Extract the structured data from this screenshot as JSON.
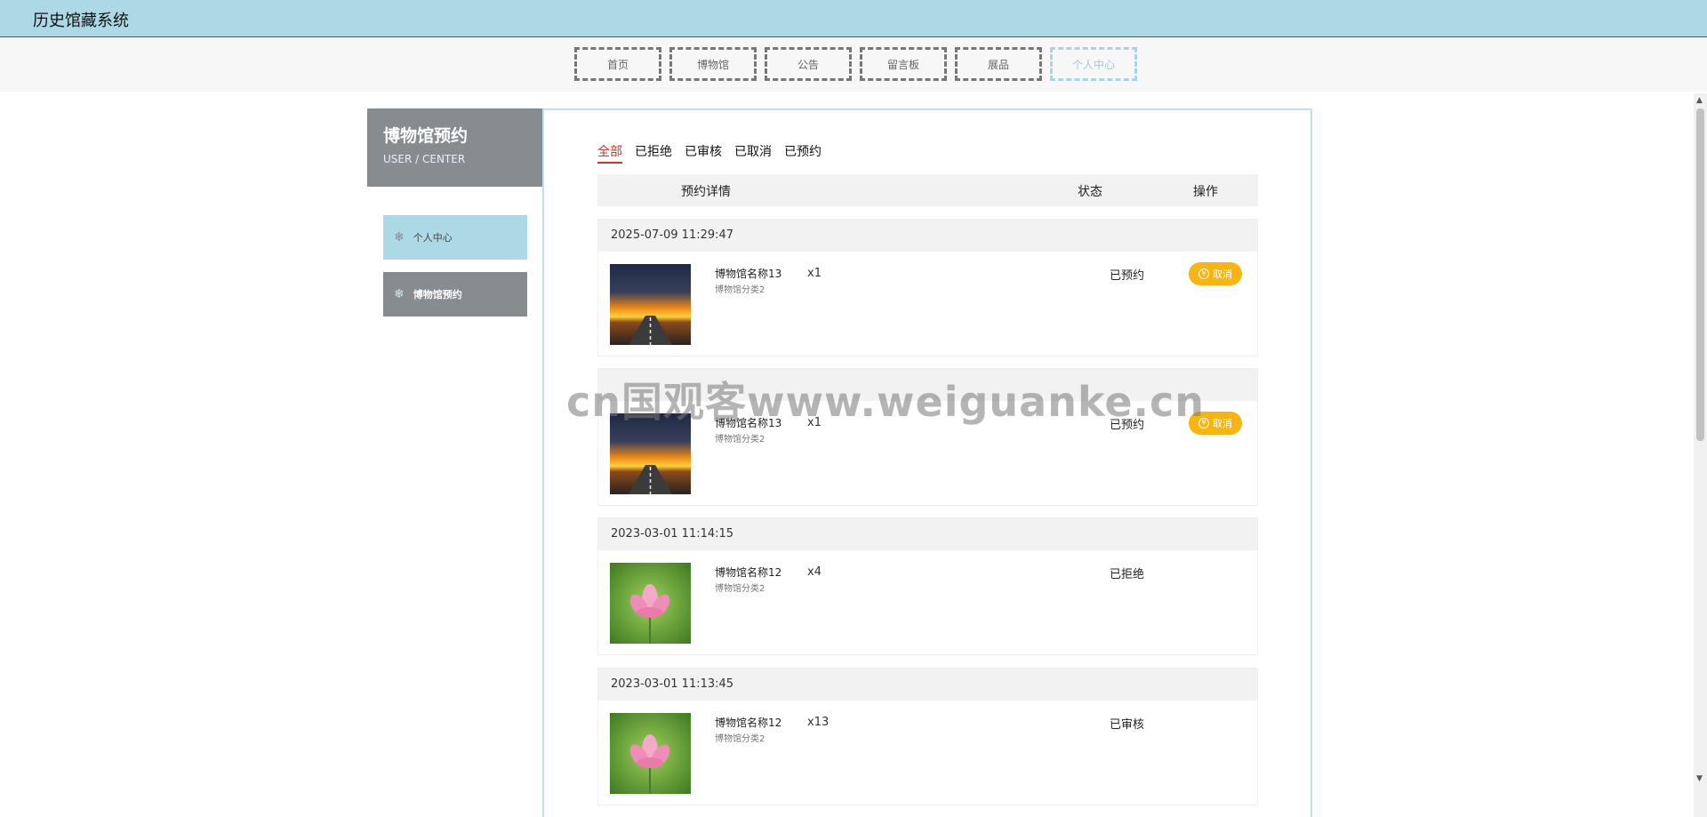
{
  "app": {
    "title": "历史馆藏系统"
  },
  "nav": {
    "items": [
      {
        "label": "首页"
      },
      {
        "label": "博物馆"
      },
      {
        "label": "公告"
      },
      {
        "label": "留言板"
      },
      {
        "label": "展品"
      },
      {
        "label": "个人中心",
        "active": true
      }
    ]
  },
  "sidebar": {
    "title": "博物馆预约",
    "subtitle": "USER / CENTER",
    "items": [
      {
        "label": "个人中心",
        "icon": "snowflake-icon"
      },
      {
        "label": "博物馆预约",
        "icon": "snowflake-icon"
      }
    ]
  },
  "filters": {
    "tabs": [
      {
        "label": "全部",
        "active": true
      },
      {
        "label": "已拒绝"
      },
      {
        "label": "已审核"
      },
      {
        "label": "已取消"
      },
      {
        "label": "已预约"
      }
    ]
  },
  "table": {
    "headers": {
      "detail": "预约详情",
      "status": "状态",
      "action": "操作"
    }
  },
  "orders": [
    {
      "time": "2025-07-09 11:29:47",
      "name": "博物馆名称13",
      "category": "博物馆分类2",
      "qty": "x1",
      "status": "已预约",
      "action": "取消",
      "image": "sunset-road"
    },
    {
      "time": "",
      "name": "博物馆名称13",
      "category": "博物馆分类2",
      "qty": "x1",
      "status": "已预约",
      "action": "取消",
      "image": "sunset-road"
    },
    {
      "time": "2023-03-01 11:14:15",
      "name": "博物馆名称12",
      "category": "博物馆分类2",
      "qty": "x4",
      "status": "已拒绝",
      "action": "",
      "image": "lotus"
    },
    {
      "time": "2023-03-01 11:13:45",
      "name": "博物馆名称12",
      "category": "博物馆分类2",
      "qty": "x13",
      "status": "已审核",
      "action": "",
      "image": "lotus"
    }
  ],
  "watermark": "cn国观客www.weiguanke.cn",
  "colors": {
    "header": "#add8e6",
    "sidebar_dark": "#868c8f",
    "accent_red": "#c0392b",
    "cancel": "#f6b511"
  }
}
